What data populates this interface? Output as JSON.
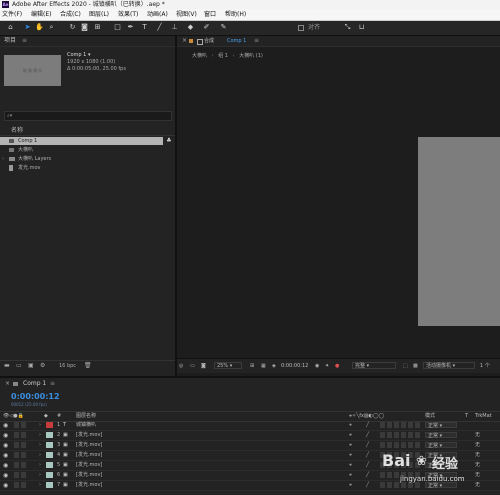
{
  "app": {
    "icon_text": "Ae",
    "title": "Adobe After Effects 2020 - 城镇横叭（已转换）.aep *"
  },
  "menu": [
    "文件(F)",
    "编辑(E)",
    "合成(C)",
    "图层(L)",
    "效果(T)",
    "动画(A)",
    "视图(V)",
    "窗口",
    "帮助(H)"
  ],
  "toolbar": {
    "snap_label": "对齐",
    "tools": [
      "home-icon",
      "selection-arrow-icon",
      "hand-icon",
      "zoom-icon",
      "rotate-icon",
      "camera-icon",
      "pan-behind-icon",
      "rectangle-icon",
      "pen-icon",
      "type-icon",
      "brush-icon",
      "clone-stamp-icon",
      "eraser-icon",
      "roto-brush-icon",
      "puppet-pin-icon"
    ]
  },
  "project": {
    "panel_title": "项目",
    "comp_name": "Comp 1 ▾",
    "comp_info1": "1920 x 1080 (1.00)",
    "comp_info2": "Δ 0:00:05:00, 25.00 fps",
    "thumbnail_text": "城 镇 横 叭",
    "search_placeholder": "",
    "column_name": "名称",
    "items": [
      {
        "name": "Comp 1",
        "type": "comp",
        "selected": true
      },
      {
        "name": "大横叭",
        "type": "comp",
        "selected": false
      },
      {
        "name": "大横叭 Layers",
        "type": "folder",
        "selected": false
      },
      {
        "name": "发光.mov",
        "type": "footage",
        "selected": false
      }
    ],
    "bpc": "16 bpc"
  },
  "viewer": {
    "panel_title": "合成",
    "comp_tab": "Comp 1",
    "breadcrumb": [
      "大横叭",
      "组 1",
      "大横叭 (1)"
    ],
    "zoom": "25%",
    "timecode": "0:00:00:12",
    "resolution": "完整",
    "camera": "活动摄像机",
    "views": "1 个"
  },
  "timeline": {
    "comp_tab": "Comp 1",
    "timecode": "0:00:00:12",
    "timecode_sub": "00012 (25.00 fps)",
    "headers": {
      "label": "#",
      "layer_name": "图层名称",
      "mode": "模式",
      "t": "T",
      "trkmat": "TrkMat"
    },
    "layers": [
      {
        "num": "1",
        "type": "T",
        "name": "城镇横叭",
        "color": "#c63c3c",
        "mode": "正常",
        "trk": ""
      },
      {
        "num": "2",
        "type": "▣",
        "name": "[发光.mov]",
        "color": "#a7c7c0",
        "mode": "正常",
        "trk": "无"
      },
      {
        "num": "3",
        "type": "▣",
        "name": "[发光.mov]",
        "color": "#a7c7c0",
        "mode": "正常",
        "trk": "无"
      },
      {
        "num": "4",
        "type": "▣",
        "name": "[发光.mov]",
        "color": "#a7c7c0",
        "mode": "正常",
        "trk": "无"
      },
      {
        "num": "5",
        "type": "▣",
        "name": "[发光.mov]",
        "color": "#a7c7c0",
        "mode": "正常",
        "trk": "无"
      },
      {
        "num": "6",
        "type": "▣",
        "name": "[发光.mov]",
        "color": "#a7c7c0",
        "mode": "正常",
        "trk": "无"
      },
      {
        "num": "7",
        "type": "▣",
        "name": "[发光.mov]",
        "color": "#a7c7c0",
        "mode": "正常",
        "trk": "无"
      }
    ]
  },
  "watermark": {
    "brand": "Bai",
    "brand2": "经验",
    "url": "jingyan.baidu.com"
  },
  "colors": {
    "accent": "#2d8ceb",
    "timecode": "#3a8fe0"
  }
}
